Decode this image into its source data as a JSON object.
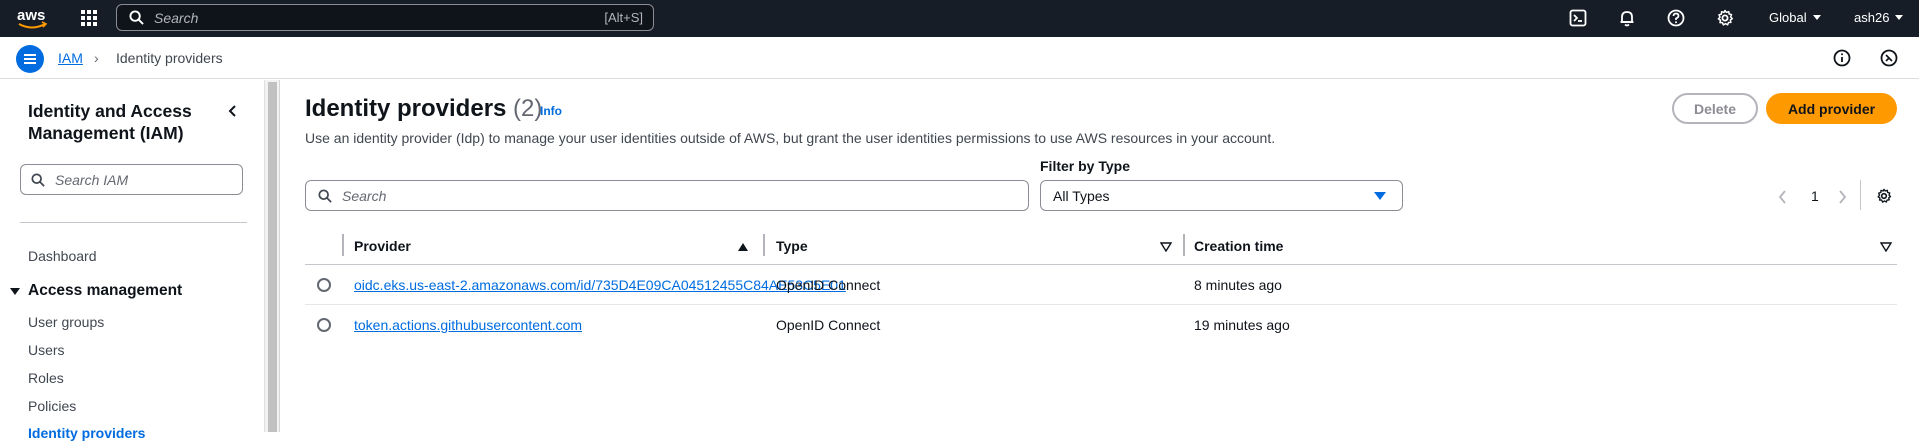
{
  "topnav": {
    "logo_text": "aws",
    "search_placeholder": "Search",
    "search_shortcut": "[Alt+S]",
    "region": "Global",
    "user": "ash26"
  },
  "breadcrumb": {
    "root": "IAM",
    "current": "Identity providers"
  },
  "sidebar": {
    "title": "Identity and Access Management (IAM)",
    "search_placeholder": "Search IAM",
    "dashboard": "Dashboard",
    "section": "Access management",
    "items": [
      "User groups",
      "Users",
      "Roles",
      "Policies",
      "Identity providers"
    ]
  },
  "main": {
    "title": "Identity providers",
    "count": "(2)",
    "info": "Info",
    "description": "Use an identity provider (Idp) to manage your user identities outside of AWS, but grant the user identities permissions to use AWS resources in your account.",
    "delete_label": "Delete",
    "add_label": "Add provider",
    "filter_label": "Filter by Type",
    "search_placeholder": "Search",
    "filter_value": "All Types",
    "page": "1",
    "columns": [
      "Provider",
      "Type",
      "Creation time"
    ],
    "rows": [
      {
        "provider": "oidc.eks.us-east-2.amazonaws.com/id/735D4E09CA04512455C84AE53C5E01",
        "type": "OpenID Connect",
        "created": "8 minutes ago"
      },
      {
        "provider": "token.actions.githubusercontent.com",
        "type": "OpenID Connect",
        "created": "19 minutes ago"
      }
    ]
  },
  "colors": {
    "nav_bg": "#161d26",
    "link": "#006ce0",
    "primary_button": "#ff9900"
  }
}
